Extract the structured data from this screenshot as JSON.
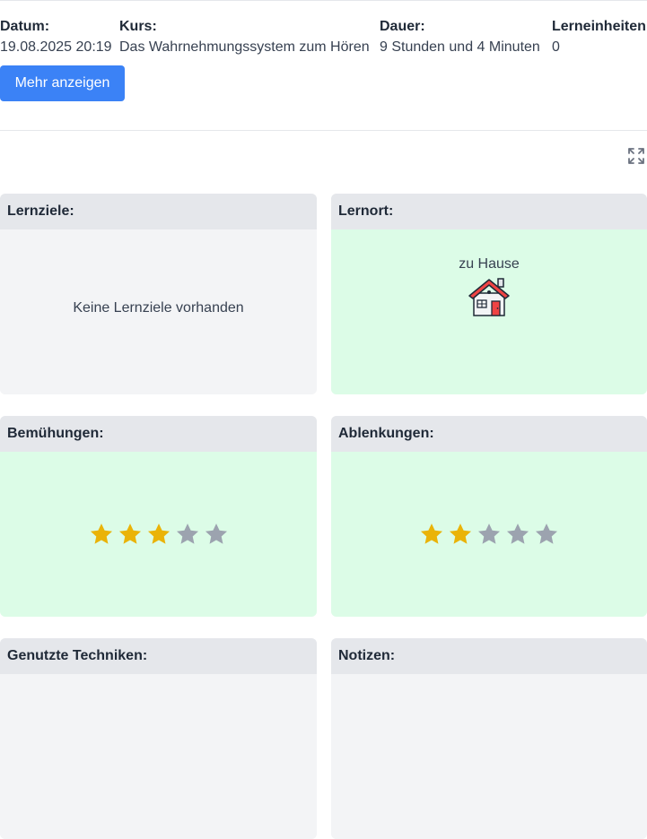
{
  "info": {
    "datum_label": "Datum:",
    "datum_value": "19.08.2025 20:19",
    "kurs_label": "Kurs:",
    "kurs_value": "Das Wahrnehmungssystem zum Hören",
    "dauer_label": "Dauer:",
    "dauer_value": "9 Stunden und 4 Minuten",
    "lerneinheiten_label": "Lerneinheiten:",
    "lerneinheiten_value": "0"
  },
  "more_button_label": "Mehr anzeigen",
  "icons": {
    "expand": "expand-icon",
    "house": "house-icon",
    "star": "star-icon"
  },
  "colors": {
    "primary": "#3b82f6",
    "green_panel": "#dcfce7",
    "gray_panel": "#f3f4f6",
    "star_filled": "#eab308",
    "star_empty": "#9ca3af"
  },
  "cards": {
    "lernziele": {
      "title": "Lernziele:",
      "empty_text": "Keine Lernziele vorhanden"
    },
    "lernort": {
      "title": "Lernort:",
      "value": "zu Hause"
    },
    "bemuehungen": {
      "title": "Bemühungen:",
      "rating": 3,
      "max": 5
    },
    "ablenkungen": {
      "title": "Ablenkungen:",
      "rating": 2,
      "max": 5
    },
    "techniken": {
      "title": "Genutzte Techniken:"
    },
    "notizen": {
      "title": "Notizen:"
    }
  }
}
